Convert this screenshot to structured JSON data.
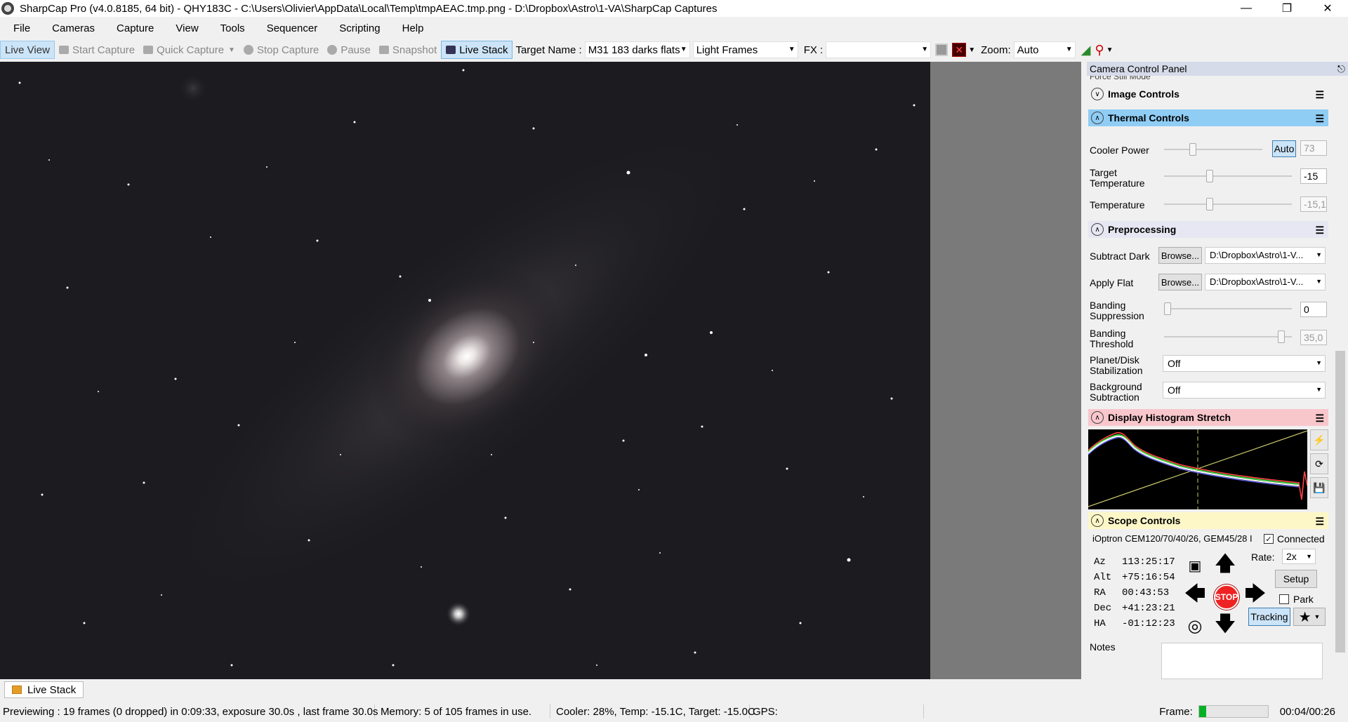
{
  "window": {
    "title": "SharpCap Pro (v4.0.8185, 64 bit) - QHY183C - C:\\Users\\Olivier\\AppData\\Local\\Temp\\tmpAEAC.tmp.png - D:\\Dropbox\\Astro\\1-VA\\SharpCap Captures"
  },
  "menu": [
    "File",
    "Cameras",
    "Capture",
    "View",
    "Tools",
    "Sequencer",
    "Scripting",
    "Help"
  ],
  "toolbar": {
    "live_view": "Live View",
    "start_capture": "Start Capture",
    "quick_capture": "Quick Capture",
    "stop_capture": "Stop Capture",
    "pause": "Pause",
    "snapshot": "Snapshot",
    "live_stack": "Live Stack",
    "target_name_label": "Target Name :",
    "target_name_value": "M31 183 darks flats",
    "frame_type": "Light Frames",
    "fx_label": "FX :",
    "fx_value": "",
    "zoom_label": "Zoom:",
    "zoom_value": "Auto"
  },
  "panel": {
    "title": "Camera Control Panel",
    "cut_label": "Force Still Mode",
    "image_controls": "Image Controls",
    "thermal_controls": "Thermal Controls",
    "cooler_power_label": "Cooler Power",
    "cooler_auto": "Auto",
    "cooler_power_value": "73",
    "target_temp_label1": "Target",
    "target_temp_label2": "Temperature",
    "target_temp_value": "-15",
    "temperature_label": "Temperature",
    "temperature_value": "-15,1",
    "preprocessing": "Preprocessing",
    "subtract_dark_label": "Subtract Dark",
    "browse": "Browse...",
    "dark_path": "D:\\Dropbox\\Astro\\1-V...",
    "apply_flat_label": "Apply Flat",
    "flat_path": "D:\\Dropbox\\Astro\\1-V...",
    "banding_supp_label1": "Banding",
    "banding_supp_label2": "Suppression",
    "banding_supp_value": "0",
    "banding_thr_label1": "Banding",
    "banding_thr_label2": "Threshold",
    "banding_thr_value": "35,0",
    "planet_label1": "Planet/Disk",
    "planet_label2": "Stabilization",
    "planet_value": "Off",
    "bg_label1": "Background",
    "bg_label2": "Subtraction",
    "bg_value": "Off",
    "histogram": "Display Histogram Stretch",
    "scope_controls": "Scope Controls",
    "mount": "iOptron CEM120/70/40/26, GEM45/28 I",
    "connected": "Connected",
    "az_label": "Az",
    "az": "113:25:17",
    "alt_label": "Alt",
    "alt": "+75:16:54",
    "ra_label": "RA",
    "ra": "00:43:53",
    "dec_label": "Dec",
    "dec": "+41:23:21",
    "ha_label": "HA",
    "ha": "-01:12:23",
    "rate_label": "Rate:",
    "rate_value": "2x",
    "setup": "Setup",
    "park": "Park",
    "tracking": "Tracking",
    "stop": "STOP",
    "notes_label": "Notes"
  },
  "bottom_tab": "Live Stack",
  "status": {
    "previewing": "Previewing : 19 frames (0 dropped) in 0:09:33, exposure 30.0s , last frame 30.0s",
    "memory": "Memory: 5 of 105 frames in use.",
    "cooler": "Cooler: 28%, Temp: -15.1C, Target: -15.0C",
    "gps": "GPS:",
    "frame_label": "Frame:",
    "frame_progress": 0.1,
    "frame_time": "00:04/00:26"
  },
  "colors": {
    "thermal_header": "#8fcdf5",
    "histo_header": "#f8c7cc",
    "scope_header": "#fdf7c8",
    "preproc_header": "#e7e7f4"
  }
}
